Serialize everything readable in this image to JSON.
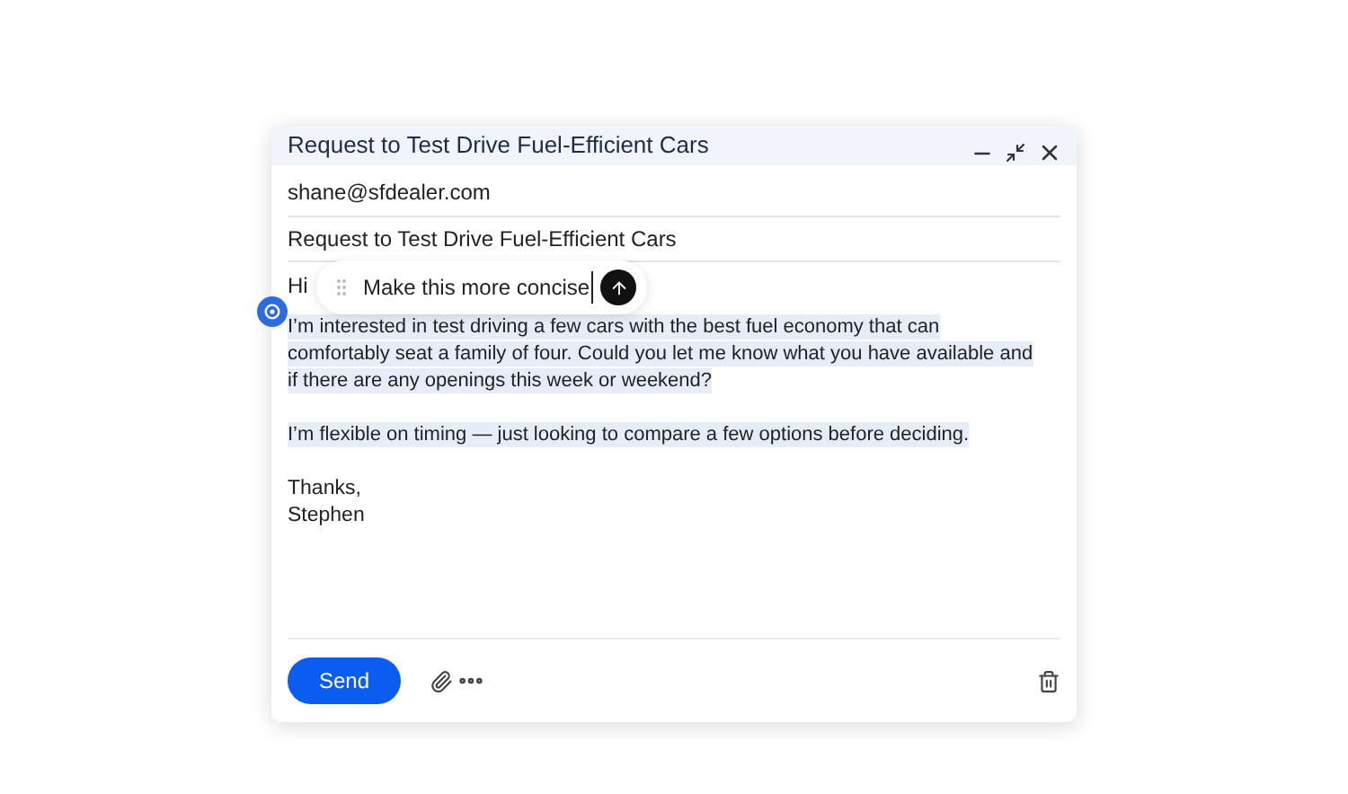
{
  "window": {
    "title": "Request to Test Drive Fuel-Efficient Cars"
  },
  "to": "shane@sfdealer.com",
  "subject": "Request to Test Drive Fuel-Efficient Cars",
  "greeting": "Hi",
  "prompt": {
    "value": "Make this more concise"
  },
  "paragraphs": [
    {
      "text": "I’m interested in test driving a few cars with the best fuel economy that can comfortably seat a family of four. Could you let me know what you have available and if there are any openings this week or weekend?",
      "highlighted": true
    },
    {
      "text": "I’m flexible on timing — just looking to compare a few options before deciding.",
      "highlighted": true
    }
  ],
  "signature": [
    "Thanks,",
    "Stephen"
  ],
  "send_button": "Send"
}
